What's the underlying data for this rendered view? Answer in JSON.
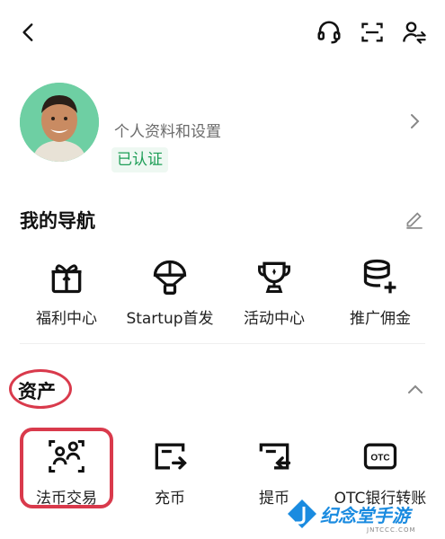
{
  "header": {
    "icons": [
      "back-arrow-icon",
      "headset-icon",
      "scan-icon",
      "switch-account-icon"
    ]
  },
  "profile": {
    "label": "个人资料和设置",
    "verified": "已认证"
  },
  "navigation": {
    "title": "我的导航",
    "items": [
      {
        "label": "福利中心",
        "icon": "gift-icon"
      },
      {
        "label": "Startup首发",
        "icon": "parachute-icon"
      },
      {
        "label": "活动中心",
        "icon": "trophy-icon"
      },
      {
        "label": "推广佣金",
        "icon": "coins-plus-icon"
      }
    ]
  },
  "assets": {
    "title": "资产",
    "items": [
      {
        "label": "法币交易",
        "icon": "p2p-users-icon"
      },
      {
        "label": "充币",
        "icon": "deposit-icon"
      },
      {
        "label": "提币",
        "icon": "withdraw-icon"
      },
      {
        "label": "OTC银行转账",
        "icon": "otc-card-icon",
        "badge": "OTC"
      }
    ]
  },
  "watermark": {
    "title": "纪念堂手游",
    "subtitle": "JNTCCC.COM"
  },
  "colors": {
    "accent_green": "#1e9e57",
    "annotation_red": "#d93a4c",
    "watermark_blue": "#1a8be0"
  }
}
